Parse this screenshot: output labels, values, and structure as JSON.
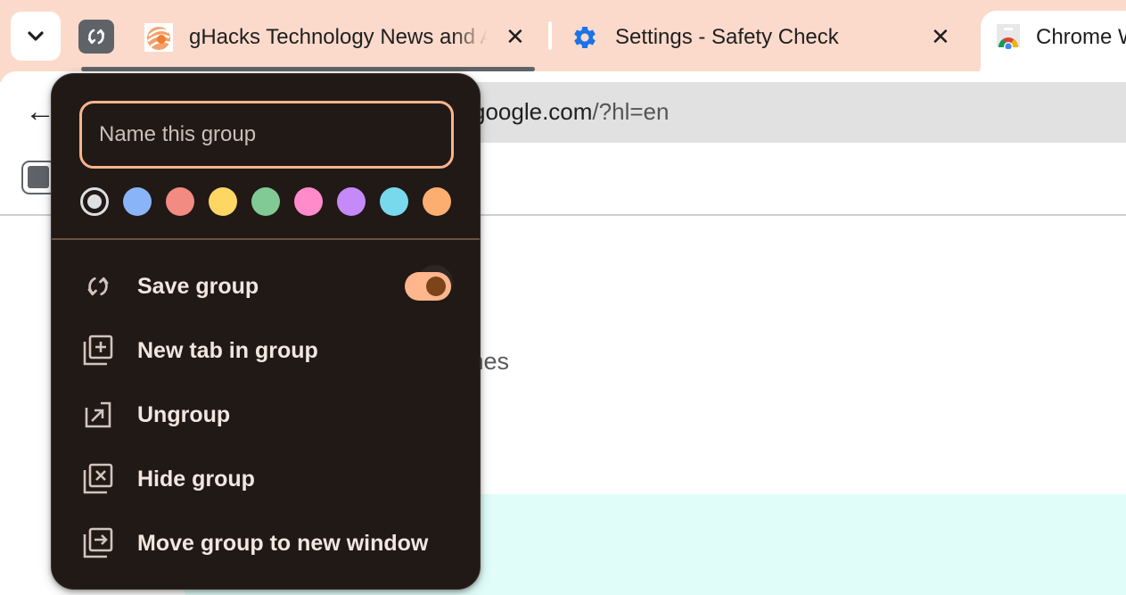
{
  "tabstrip": {
    "tab_search_icon": "chevron-down-icon",
    "group_chip_icon": "sync-saved-group-icon",
    "group_color": "#5f6368",
    "tabs": [
      {
        "title": "gHacks Technology News and Advice",
        "favicon": "ghacks-favicon",
        "close_label": "✕"
      },
      {
        "title": "Settings - Safety Check",
        "favicon": "gear-icon",
        "close_label": "✕"
      },
      {
        "title": "Chrome W",
        "favicon": "chrome-web-store-icon",
        "active": true
      }
    ]
  },
  "toolbar": {
    "back_label": "←",
    "url_host": "google.com",
    "url_rest": "/?hl=en",
    "url_prefix_hidden": "g"
  },
  "page": {
    "partial_text": "mes",
    "banner_color": "#e0fdf9"
  },
  "group_editor": {
    "name_input": {
      "value": "",
      "placeholder": "Name this group"
    },
    "colors": [
      {
        "name": "grey",
        "hex": "#dedfe3",
        "selected": true
      },
      {
        "name": "blue",
        "hex": "#8ab4f8",
        "selected": false
      },
      {
        "name": "red",
        "hex": "#f28b82",
        "selected": false
      },
      {
        "name": "yellow",
        "hex": "#fdd663",
        "selected": false
      },
      {
        "name": "green",
        "hex": "#81c995",
        "selected": false
      },
      {
        "name": "pink",
        "hex": "#ff8bcb",
        "selected": false
      },
      {
        "name": "purple",
        "hex": "#c58af9",
        "selected": false
      },
      {
        "name": "cyan",
        "hex": "#78d9ec",
        "selected": false
      },
      {
        "name": "orange",
        "hex": "#fcad70",
        "selected": false
      }
    ],
    "menu": [
      {
        "label": "Save group",
        "icon": "sync-icon",
        "toggle": true,
        "toggle_on": true
      },
      {
        "label": "New tab in group",
        "icon": "new-tab-in-group-icon"
      },
      {
        "label": "Ungroup",
        "icon": "ungroup-icon"
      },
      {
        "label": "Hide group",
        "icon": "hide-group-icon"
      },
      {
        "label": "Move group to new window",
        "icon": "move-to-window-icon"
      }
    ],
    "accent_color": "#f8b48e",
    "background_color": "#211916"
  }
}
